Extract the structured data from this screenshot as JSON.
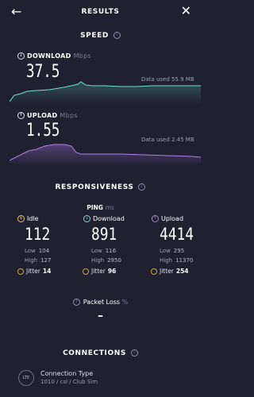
{
  "header": {
    "title": "RESULTS",
    "back_icon": "arrow-left-icon",
    "close_icon": "close-icon"
  },
  "speed": {
    "heading": "SPEED",
    "download": {
      "label": "DOWNLOAD",
      "unit": "Mbps",
      "value": "37.5",
      "data_used": "Data used 55.9 MB",
      "color": "#6fe0d2"
    },
    "upload": {
      "label": "UPLOAD",
      "unit": "Mbps",
      "value": "1.55",
      "data_used": "Data used 2.45 MB",
      "color": "#b07ee8"
    }
  },
  "responsiveness": {
    "heading": "RESPONSIVENESS",
    "ping_label": "PING",
    "ping_unit": "ms",
    "idle": {
      "label": "Idle",
      "value": "112",
      "low_label": "Low",
      "low": "104",
      "high_label": "High",
      "high": "127",
      "jitter_label": "Jitter",
      "jitter": "14"
    },
    "download": {
      "label": "Download",
      "value": "891",
      "low_label": "Low",
      "low": "116",
      "high_label": "High",
      "high": "2950",
      "jitter_label": "Jitter",
      "jitter": "96"
    },
    "upload": {
      "label": "Upload",
      "value": "4414",
      "low_label": "Low",
      "low": "295",
      "high_label": "High",
      "high": "11370",
      "jitter_label": "Jitter",
      "jitter": "254"
    },
    "packet_loss_label": "Packet Loss",
    "packet_loss_unit": "%",
    "packet_loss_value": "–"
  },
  "connections": {
    "heading": "CONNECTIONS",
    "icon_text": "LTE",
    "type_label": "Connection Type",
    "type_value": "1010 / csl / Club Sim"
  }
}
